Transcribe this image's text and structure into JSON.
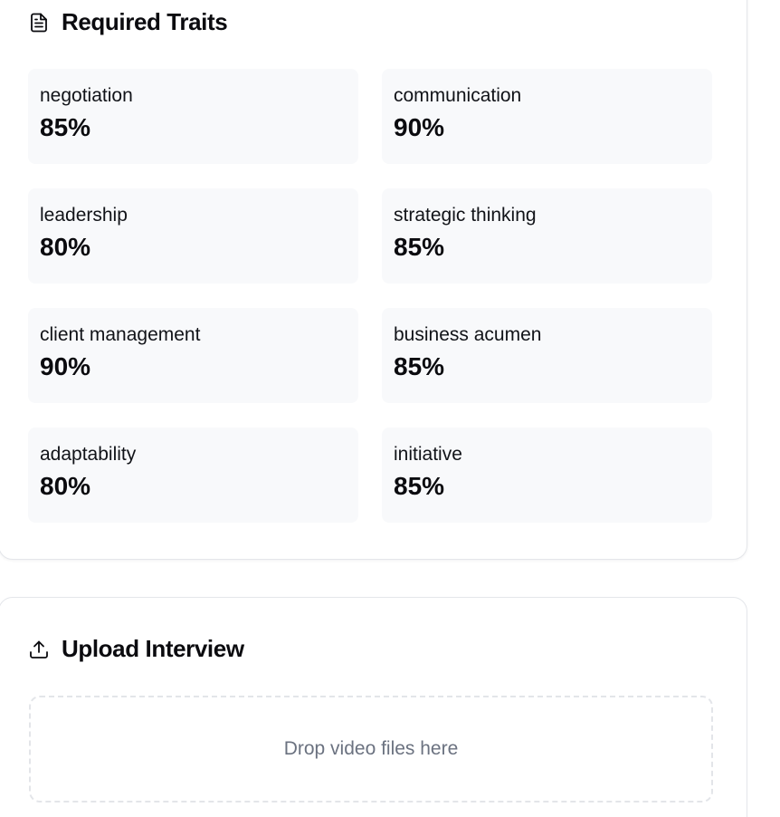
{
  "traits_card": {
    "title": "Required Traits",
    "icon": "file-text-icon",
    "traits": [
      {
        "name": "negotiation",
        "value": "85%"
      },
      {
        "name": "communication",
        "value": "90%"
      },
      {
        "name": "leadership",
        "value": "80%"
      },
      {
        "name": "strategic thinking",
        "value": "85%"
      },
      {
        "name": "client management",
        "value": "90%"
      },
      {
        "name": "business acumen",
        "value": "85%"
      },
      {
        "name": "adaptability",
        "value": "80%"
      },
      {
        "name": "initiative",
        "value": "85%"
      }
    ]
  },
  "upload_card": {
    "title": "Upload Interview",
    "icon": "upload-icon",
    "dropzone_text": "Drop video files here"
  },
  "colors": {
    "tile_background": "#f8f9fb",
    "border": "#e4e6ea",
    "muted_text": "#6b7280"
  }
}
